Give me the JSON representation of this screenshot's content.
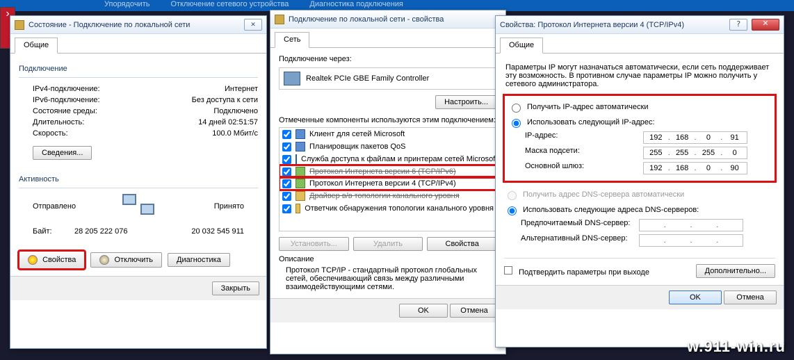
{
  "parent_bar": {
    "a": "Упорядочить",
    "b": "Отключение сетевого устройства",
    "c": "Диагностика подключения"
  },
  "watermark": "w.911-win.ru",
  "w1": {
    "title": "Состояние - Подключение по локальной сети",
    "tab": "Общие",
    "conn_title": "Подключение",
    "rows": [
      {
        "k": "IPv4-подключение:",
        "v": "Интернет"
      },
      {
        "k": "IPv6-подключение:",
        "v": "Без доступа к сети"
      },
      {
        "k": "Состояние среды:",
        "v": "Подключено"
      },
      {
        "k": "Длительность:",
        "v": "14 дней 02:51:57"
      },
      {
        "k": "Скорость:",
        "v": "100.0 Мбит/с"
      }
    ],
    "details_btn": "Сведения...",
    "activity_title": "Активность",
    "sent_lbl": "Отправлено",
    "recv_lbl": "Принято",
    "bytes_lbl": "Байт:",
    "sent_val": "28 205 222 076",
    "recv_val": "20 032 545 911",
    "props_btn": "Свойства",
    "disable_btn": "Отключить",
    "diag_btn": "Диагностика",
    "close_btn": "Закрыть"
  },
  "w2": {
    "title": "Подключение по локальной сети - свойства",
    "tab": "Сеть",
    "via": "Подключение через:",
    "nic": "Realtek PCIe GBE Family Controller",
    "configure_btn": "Настроить...",
    "comp_label": "Отмеченные компоненты используются этим подключением:",
    "items": [
      "Клиент для сетей Microsoft",
      "Планировщик пакетов QoS",
      "Служба доступа к файлам и принтерам сетей Microsoft",
      "Протокол Интернета версии 6 (TCP/IPv6)",
      "Протокол Интернета версии 4 (TCP/IPv4)",
      "Драйвер в/в топологии канального уровня",
      "Ответчик обнаружения топологии канального уровня"
    ],
    "install_btn": "Установить...",
    "remove_btn": "Удалить",
    "props_btn": "Свойства",
    "desc_title": "Описание",
    "desc_text": "Протокол TCP/IP - стандартный протокол глобальных сетей, обеспечивающий связь между различными взаимодействующими сетями.",
    "ok": "OK",
    "cancel": "Отмена"
  },
  "w3": {
    "title": "Свойства: Протокол Интернета версии 4 (TCP/IPv4)",
    "tab": "Общие",
    "intro": "Параметры IP могут назначаться автоматически, если сеть поддерживает эту возможность. В противном случае параметры IP можно получить у сетевого администратора.",
    "opt_auto_ip": "Получить IP-адрес автоматически",
    "opt_static_ip": "Использовать следующий IP-адрес:",
    "ip_label": "IP-адрес:",
    "ip": [
      "192",
      "168",
      "0",
      "91"
    ],
    "mask_label": "Маска подсети:",
    "mask": [
      "255",
      "255",
      "255",
      "0"
    ],
    "gw_label": "Основной шлюз:",
    "gw": [
      "192",
      "168",
      "0",
      "90"
    ],
    "opt_auto_dns": "Получить адрес DNS-сервера автоматически",
    "opt_static_dns": "Использовать следующие адреса DNS-серверов:",
    "dns1_label": "Предпочитаемый DNS-сервер:",
    "dns2_label": "Альтернативный DNS-сервер:",
    "validate": "Подтвердить параметры при выходе",
    "advanced_btn": "Дополнительно...",
    "ok": "OK",
    "cancel": "Отмена"
  }
}
